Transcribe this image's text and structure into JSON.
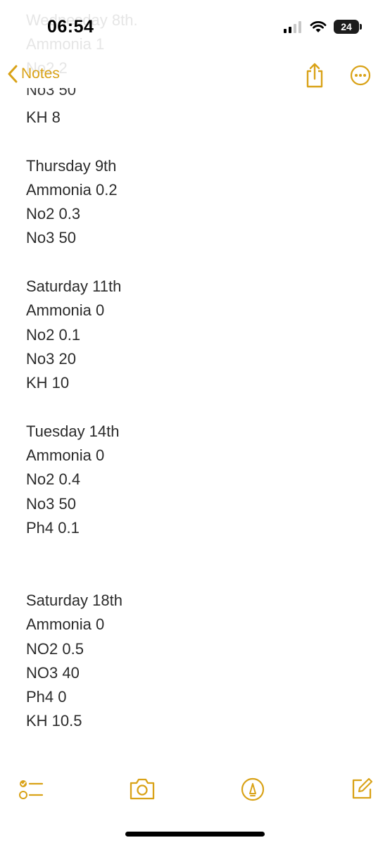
{
  "status": {
    "time": "06:54",
    "battery": "24"
  },
  "nav": {
    "back_label": "Notes"
  },
  "ghost_lines": [
    "Wednesday 8th.",
    "Ammonia 1",
    "No2 2"
  ],
  "cut_line": "No3 50",
  "note": {
    "top_lines": [
      "KH 8"
    ],
    "entries": [
      {
        "day": "Thursday 9th",
        "lines": [
          "Ammonia 0.2",
          "No2 0.3",
          "No3 50"
        ]
      },
      {
        "day": "Saturday 11th",
        "lines": [
          "Ammonia 0",
          "No2 0.1",
          "No3 20",
          "KH 10"
        ]
      },
      {
        "day": "Tuesday 14th",
        "lines": [
          "Ammonia 0",
          "No2 0.4",
          "No3 50",
          "Ph4 0.1"
        ]
      },
      {
        "day": "Saturday 18th",
        "lines": [
          "Ammonia 0",
          "NO2 0.5",
          "NO3 40",
          "Ph4 0",
          "KH 10.5"
        ]
      }
    ]
  },
  "icons": {
    "back": "chevron-left-icon",
    "share": "share-icon",
    "more": "more-icon",
    "checklist": "checklist-icon",
    "camera": "camera-icon",
    "markup": "markup-icon",
    "compose": "compose-icon"
  },
  "colors": {
    "accent": "#d9a217",
    "text": "#2b2b2b",
    "background": "#ffffff"
  }
}
